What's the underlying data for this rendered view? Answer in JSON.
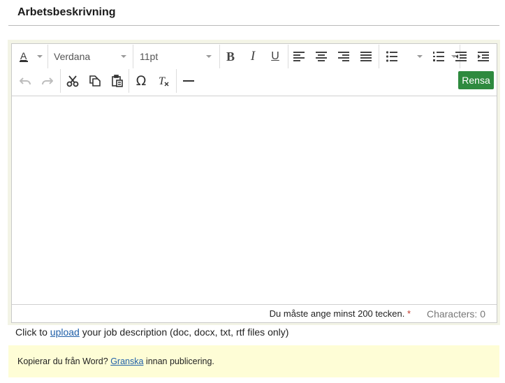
{
  "section": {
    "title": "Arbetsbeskrivning"
  },
  "toolbar": {
    "font_family": "Verdana",
    "font_size": "11pt",
    "bold_glyph": "B",
    "italic_glyph": "I",
    "underline_glyph": "U",
    "rensa_label": "Rensa",
    "icons": [
      "text-color-icon",
      "bold-icon",
      "italic-icon",
      "underline-icon",
      "align-left-icon",
      "align-center-icon",
      "align-right-icon",
      "align-justify-icon",
      "bullet-list-icon",
      "numbered-list-icon",
      "outdent-icon",
      "indent-icon",
      "undo-icon",
      "redo-icon",
      "cut-icon",
      "copy-icon",
      "paste-icon",
      "omega-icon",
      "clear-format-icon",
      "horizontal-rule-icon"
    ]
  },
  "status": {
    "min_text": "Du måste ange minst 200 tecken.",
    "required_mark": "*",
    "characters": "Characters: 0"
  },
  "upload": {
    "prefix": "Click to ",
    "link": "upload",
    "suffix": " your job description (doc, docx, txt, rtf files only)"
  },
  "word_notice": {
    "prefix": "Kopierar du från Word? ",
    "link": "Granska",
    "suffix": " innan publicering."
  },
  "colors": {
    "rensa_bg": "#2e8a3e",
    "notice_bg": "#fefdd6",
    "link": "#1f5fa8",
    "editor_frame": "#f3f4e6"
  }
}
